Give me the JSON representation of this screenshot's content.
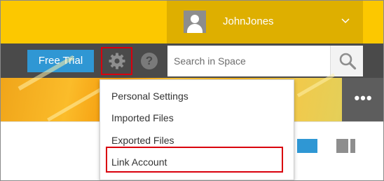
{
  "header": {
    "username": "JohnJones",
    "avatar_icon": "user-silhouette-icon",
    "dropdown_icon": "chevron-down-icon"
  },
  "toolbar": {
    "free_trial_label": "Free Trial",
    "settings_icon": "gear-icon",
    "help_icon": "question-circle-icon",
    "help_glyph": "?",
    "search": {
      "placeholder": "Search in Space",
      "icon": "search-icon"
    }
  },
  "banner": {
    "more_label": "•••"
  },
  "view_toggles": [
    "grid-view-icon",
    "list-view-icon"
  ],
  "settings_menu": {
    "items": [
      {
        "label": "Personal Settings"
      },
      {
        "label": "Imported Files"
      },
      {
        "label": "Exported Files"
      },
      {
        "label": "Link Account",
        "highlighted": true
      }
    ]
  },
  "colors": {
    "header_yellow": "#fcc800",
    "user_area": "#deaf00",
    "toolbar": "#4a4a4a",
    "accent_blue": "#2f97d4",
    "highlight_red": "#d9000d"
  }
}
